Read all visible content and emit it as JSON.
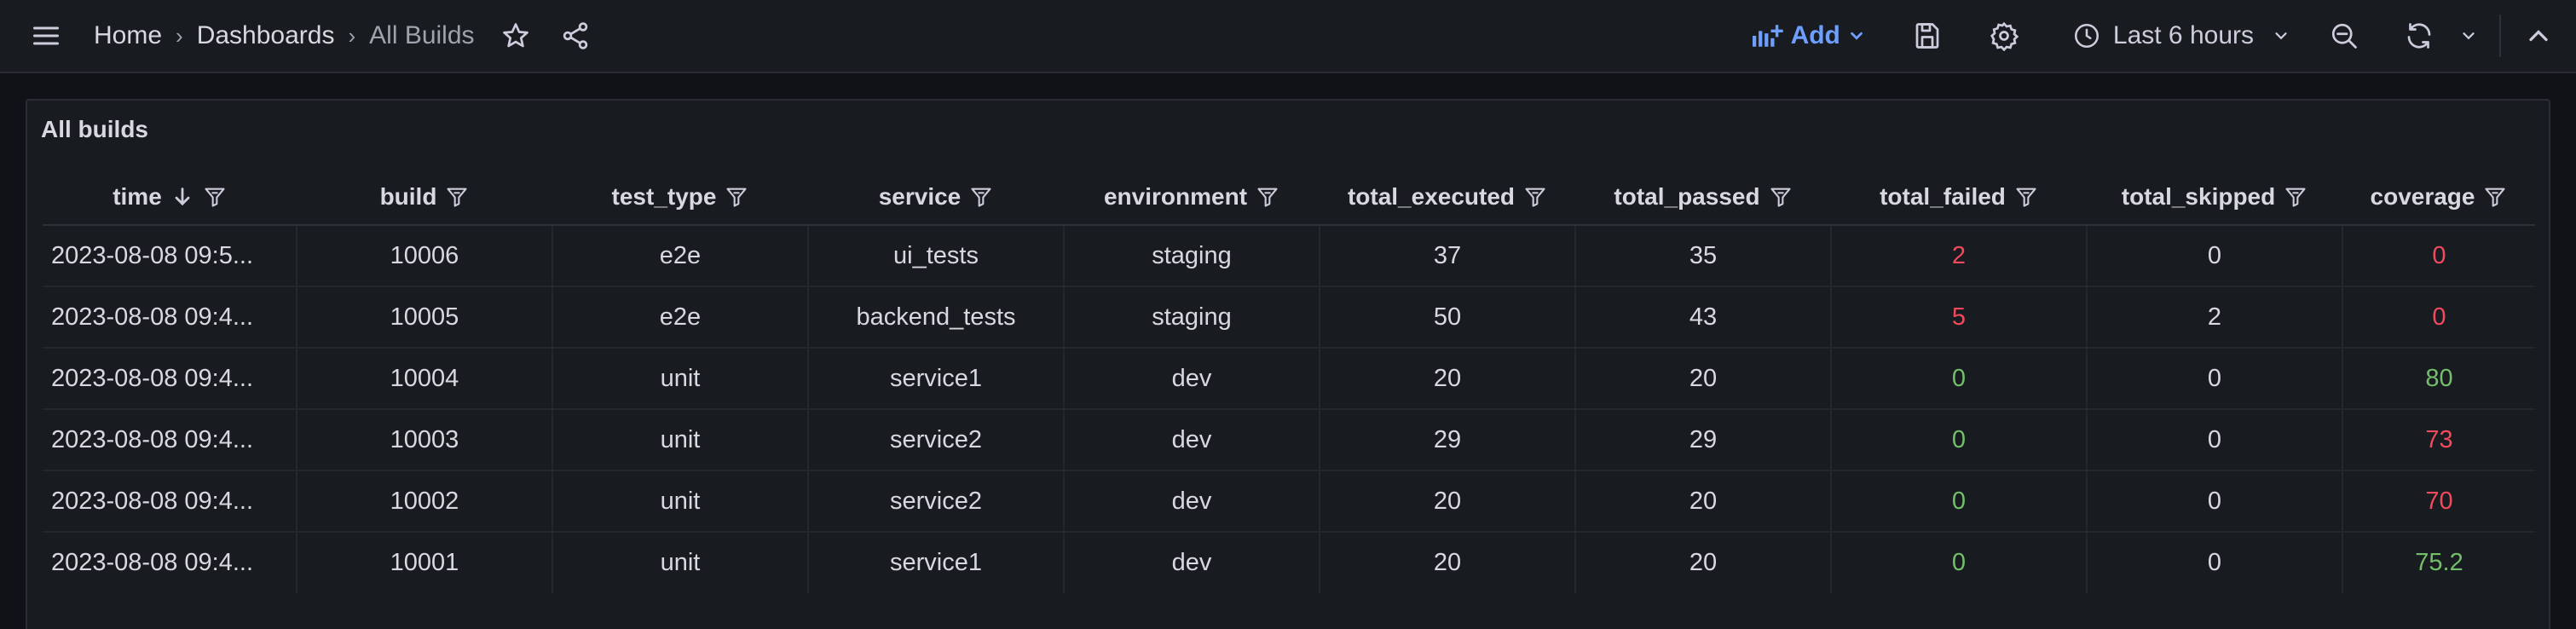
{
  "breadcrumb": {
    "home": "Home",
    "dashboards": "Dashboards",
    "current": "All Builds"
  },
  "toolbar": {
    "add_label": "Add",
    "time_range": "Last 6 hours"
  },
  "panel": {
    "title": "All builds",
    "columns": [
      "time",
      "build",
      "test_type",
      "service",
      "environment",
      "total_executed",
      "total_passed",
      "total_failed",
      "total_skipped",
      "coverage"
    ],
    "rows": [
      [
        "2023-08-08 09:5...",
        "10006",
        "e2e",
        "ui_tests",
        "staging",
        "37",
        "35",
        "2",
        "0",
        "0"
      ],
      [
        "2023-08-08 09:4...",
        "10005",
        "e2e",
        "backend_tests",
        "staging",
        "50",
        "43",
        "5",
        "2",
        "0"
      ],
      [
        "2023-08-08 09:4...",
        "10004",
        "unit",
        "service1",
        "dev",
        "20",
        "20",
        "0",
        "0",
        "80"
      ],
      [
        "2023-08-08 09:4...",
        "10003",
        "unit",
        "service2",
        "dev",
        "29",
        "29",
        "0",
        "0",
        "73"
      ],
      [
        "2023-08-08 09:4...",
        "10002",
        "unit",
        "service2",
        "dev",
        "20",
        "20",
        "0",
        "0",
        "70"
      ],
      [
        "2023-08-08 09:4...",
        "10001",
        "unit",
        "service1",
        "dev",
        "20",
        "20",
        "0",
        "0",
        "75.2"
      ]
    ]
  },
  "colors": {
    "failed_red": "#f2495c",
    "ok_green": "#73bf69",
    "accent": "#6e9fff"
  },
  "icons": [
    "menu-icon",
    "star-icon",
    "share-icon",
    "add-panel-icon",
    "save-icon",
    "settings-icon",
    "clock-icon",
    "zoom-out-icon",
    "refresh-icon",
    "chevron-up-icon",
    "filter-icon",
    "sort-desc-icon"
  ]
}
